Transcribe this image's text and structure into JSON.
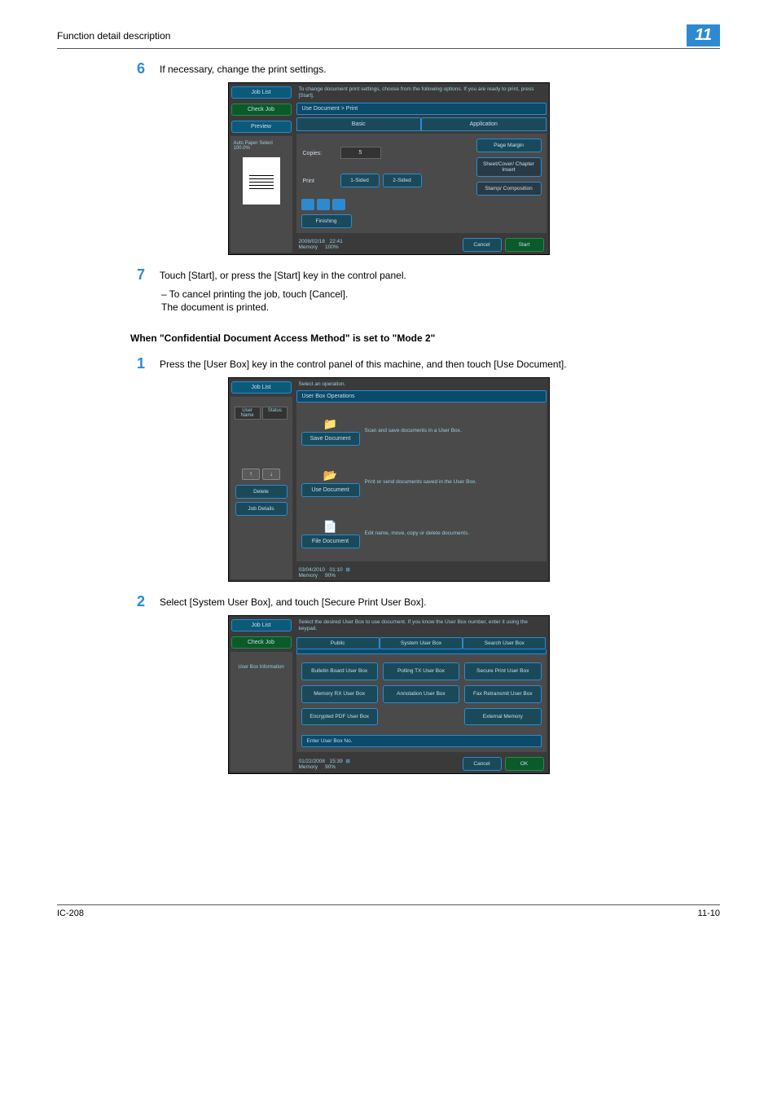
{
  "header": {
    "title": "Function detail description",
    "chapter": "11"
  },
  "step6": {
    "num": "6",
    "text": "If necessary, change the print settings.",
    "ui": {
      "job_list": "Job List",
      "check_job": "Check Job",
      "preview": "Preview",
      "auto_paper": "Auto Paper Select 100.0%",
      "hint": "To change document print settings, choose from the following options. If you are ready to print, press [Start].",
      "breadcrumb": "Use Document > Print",
      "tab_basic": "Basic",
      "tab_application": "Application",
      "copies_label": "Copies:",
      "copies_value": "5",
      "print_label": "Print",
      "one_sided": "1-Sided",
      "two_sided": "2-Sided",
      "btn_page_margin": "Page Margin",
      "btn_sheet_cover": "Sheet/Cover/ Chapter Insert",
      "btn_stamp": "Stamp/ Composition",
      "finishing": "Finishing",
      "footer_date": "2008/02/18",
      "footer_time": "22:41",
      "footer_mem": "Memory",
      "footer_mem_val": "100%",
      "cancel": "Cancel",
      "start": "Start"
    }
  },
  "step7": {
    "num": "7",
    "text": "Touch [Start], or press the [Start] key in the control panel.",
    "sub1": "–   To cancel printing the job, touch [Cancel].",
    "sub2": "The document is printed."
  },
  "heading_mode2": "When \"Confidential Document Access Method\" is set to \"Mode 2\"",
  "step1": {
    "num": "1",
    "text": "Press the [User Box] key in the control panel of this machine, and then touch [Use Document].",
    "ui": {
      "job_list": "Job List",
      "hint": "Select an operation.",
      "ops_title": "User Box Operations",
      "user_name": "User Name",
      "status": "Status",
      "save_btn": "Save Document",
      "save_desc": "Scan and save documents in a User Box.",
      "use_btn": "Use Document",
      "use_desc": "Print or send documents saved in the User Box.",
      "file_btn": "File Document",
      "file_desc": "Edit name, move, copy or delete documents.",
      "delete": "Delete",
      "job_details": "Job Details",
      "footer_date": "03/04/2010",
      "footer_time": "01:10",
      "footer_mem": "Memory",
      "footer_mem_val": "90%"
    }
  },
  "step2": {
    "num": "2",
    "text": "Select [System User Box], and touch [Secure Print User Box].",
    "ui": {
      "job_list": "Job List",
      "check_job": "Check Job",
      "user_box_info": "User Box Information",
      "hint": "Select the desired User Box to use document. If you know the User Box number, enter it using the keypad.",
      "tab_public": "Public",
      "tab_system": "System User Box",
      "tab_search": "Search User Box",
      "b1": "Bulletin Board User Box",
      "b2": "Polling TX User Box",
      "b3": "Secure Print User Box",
      "b4": "Memory RX User Box",
      "b5": "Annotation User Box",
      "b6": "Fax Retransmit User Box",
      "b7": "Encrypted PDF User Box",
      "b8": "External Memory",
      "enter": "Enter User Box No.",
      "footer_date": "01/22/2008",
      "footer_time": "15:39",
      "footer_mem": "Memory",
      "footer_mem_val": "90%",
      "cancel": "Cancel",
      "ok": "OK"
    }
  },
  "footer": {
    "left": "IC-208",
    "right": "11-10"
  }
}
